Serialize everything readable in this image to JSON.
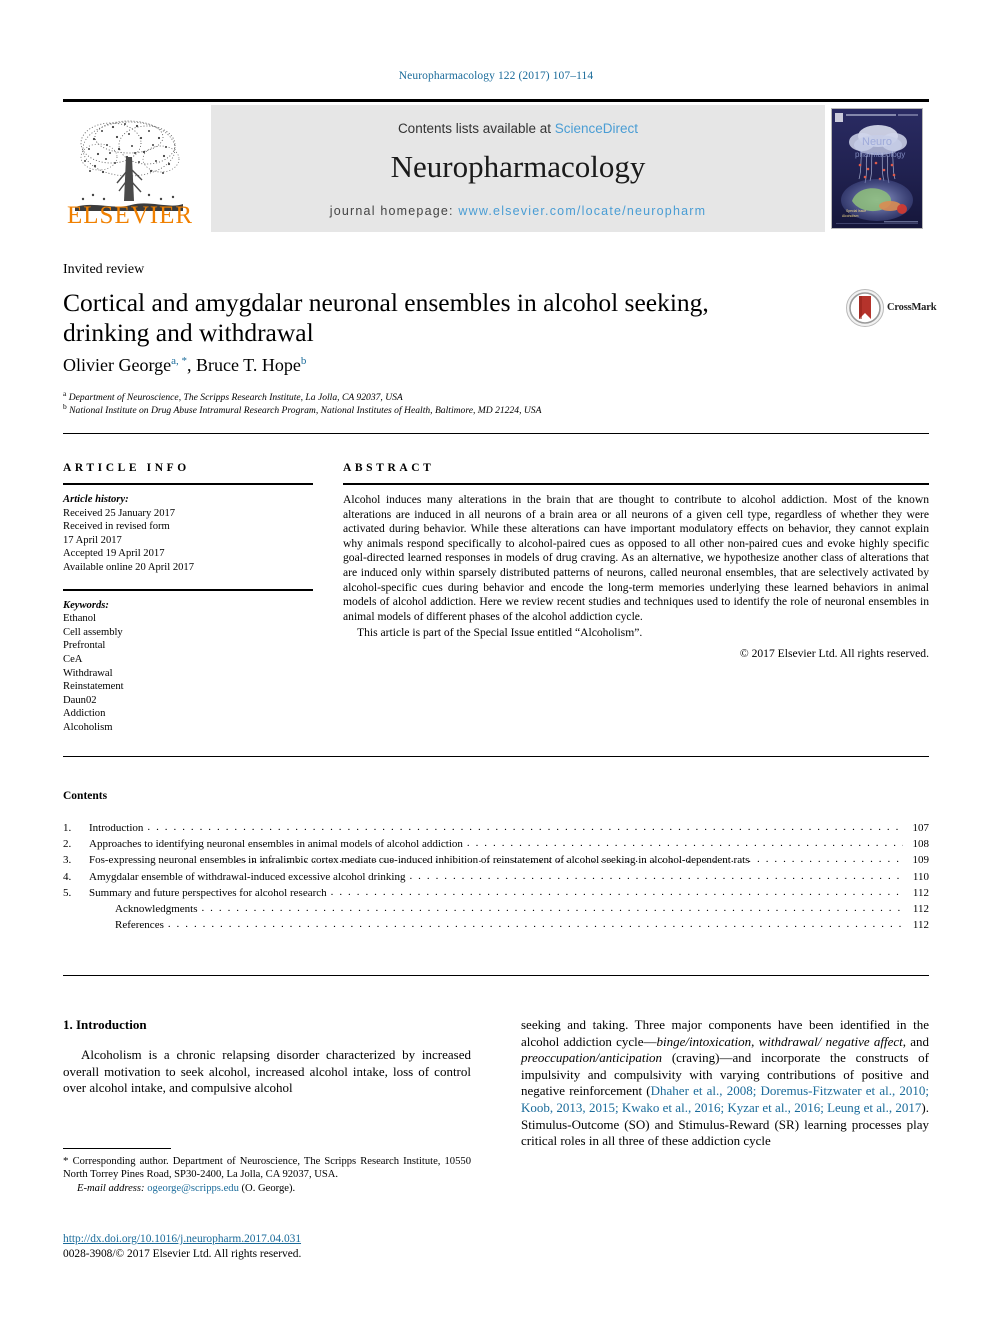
{
  "running_head": "Neuropharmacology 122 (2017) 107–114",
  "masthead": {
    "contents_prefix": "Contents lists available at ",
    "sciencedirect": "ScienceDirect",
    "journal_name": "Neuropharmacology",
    "homepage_prefix": "journal homepage: ",
    "homepage_url": "www.elsevier.com/locate/neuropharm",
    "publisher": "ELSEVIER",
    "publisher_color": "#F08000",
    "link_color": "#4a9dd4",
    "band_color": "#e6e6e6"
  },
  "article": {
    "type_label": "Invited review",
    "title": "Cortical and amygdalar neuronal ensembles in alcohol seeking, drinking and withdrawal",
    "authors": "Olivier George, Bruce T. Hope",
    "author1_name": "Olivier George",
    "author1_sup": "a, *",
    "author2_name": "Bruce T. Hope",
    "author2_sup": "b",
    "affiliation_a_sup": "a",
    "affiliation_a": "Department of Neuroscience, The Scripps Research Institute, La Jolla, CA 92037, USA",
    "affiliation_b_sup": "b",
    "affiliation_b": "National Institute on Drug Abuse Intramural Research Program, National Institutes of Health, Baltimore, MD 21224, USA",
    "crossmark_label": "CrossMark"
  },
  "article_info": {
    "heading": "ARTICLE INFO",
    "history_label": "Article history:",
    "history": [
      "Received 25 January 2017",
      "Received in revised form",
      "17 April 2017",
      "Accepted 19 April 2017",
      "Available online 20 April 2017"
    ],
    "keywords_label": "Keywords:",
    "keywords": [
      "Ethanol",
      "Cell assembly",
      "Prefrontal",
      "CeA",
      "Withdrawal",
      "Reinstatement",
      "Daun02",
      "Addiction",
      "Alcoholism"
    ]
  },
  "abstract": {
    "heading": "ABSTRACT",
    "paragraph1": "Alcohol induces many alterations in the brain that are thought to contribute to alcohol addiction. Most of the known alterations are induced in all neurons of a brain area or all neurons of a given cell type, regardless of whether they were activated during behavior. While these alterations can have important modulatory effects on behavior, they cannot explain why animals respond specifically to alcohol-paired cues as opposed to all other non-paired cues and evoke highly specific goal-directed learned responses in models of drug craving. As an alternative, we hypothesize another class of alterations that are induced only within sparsely distributed patterns of neurons, called neuronal ensembles, that are selectively activated by alcohol-specific cues during behavior and encode the long-term memories underlying these learned behaviors in animal models of alcohol addiction. Here we review recent studies and techniques used to identify the role of neuronal ensembles in animal models of different phases of the alcohol addiction cycle.",
    "paragraph2": "This article is part of the Special Issue entitled “Alcoholism”.",
    "copyright": "© 2017 Elsevier Ltd. All rights reserved."
  },
  "contents": {
    "heading": "Contents",
    "entries": [
      {
        "num": "1.",
        "label": "Introduction",
        "page": "107",
        "sub": false,
        "wrap": false
      },
      {
        "num": "2.",
        "label": "Approaches to identifying neuronal ensembles in animal models of alcohol addiction",
        "page": "108",
        "sub": false,
        "wrap": false
      },
      {
        "num": "3.",
        "label": "Fos-expressing neuronal ensembles in infralimbic cortex mediate cue-induced inhibition of reinstatement of alcohol seeking in alcohol-dependent rats",
        "page": "109",
        "sub": false,
        "wrap": true
      },
      {
        "num": "4.",
        "label": "Amygdalar ensemble of withdrawal-induced excessive alcohol drinking",
        "page": "110",
        "sub": false,
        "wrap": false
      },
      {
        "num": "5.",
        "label": "Summary and future perspectives for alcohol research",
        "page": "112",
        "sub": false,
        "wrap": false
      },
      {
        "num": "",
        "label": "Acknowledgments",
        "page": "112",
        "sub": true,
        "wrap": false
      },
      {
        "num": "",
        "label": "References",
        "page": "112",
        "sub": true,
        "wrap": false
      }
    ]
  },
  "body": {
    "section_number_title": "1. Introduction",
    "left_paragraph": "Alcoholism is a chronic relapsing disorder characterized by increased overall motivation to seek alcohol, increased alcohol intake, loss of control over alcohol intake, and compulsive alcohol",
    "right_part1": "seeking and taking. Three major components have been identified in the alcohol addiction cycle—",
    "right_italic1": "binge/intoxication",
    "right_part2": ", ",
    "right_italic2": "withdrawal/ negative affect",
    "right_part3": ", and ",
    "right_italic3": "preoccupation/anticipation",
    "right_part4": " (craving)—and incorporate the constructs of impulsivity and compulsivity with varying contributions of positive and negative reinforcement (",
    "right_citation": "Dhaher et al., 2008; Doremus-Fitzwater et al., 2010; Koob, 2013, 2015; Kwako et al., 2016; Kyzar et al., 2016; Leung et al., 2017",
    "right_part5": "). Stimulus-Outcome (SO) and Stimulus-Reward (SR) learning processes play critical roles in all three of these addiction cycle"
  },
  "footnote": {
    "star": "*",
    "corresponding": "Corresponding author. Department of Neuroscience, The Scripps Research Institute, 10550 North Torrey Pines Road, SP30-2400, La Jolla, CA 92037, USA.",
    "email_label": "E-mail address:",
    "email": "ogeorge@scripps.edu",
    "email_owner": "(O. George).",
    "doi": "http://dx.doi.org/10.1016/j.neuropharm.2017.04.031",
    "issn_line": "0028-3908/© 2017 Elsevier Ltd. All rights reserved."
  },
  "colors": {
    "link": "#1a6b9a",
    "accent_orange": "#F08000",
    "crossmark_red": "#B5332B"
  }
}
